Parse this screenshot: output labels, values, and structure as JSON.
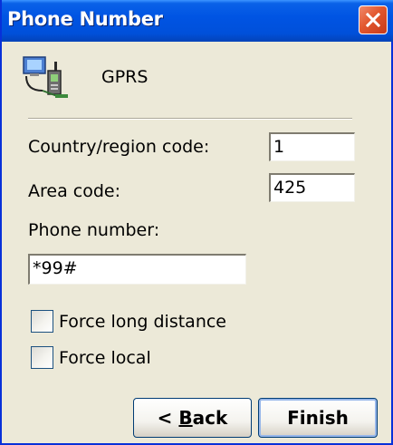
{
  "window": {
    "title": "Phone Number"
  },
  "connection": {
    "icon": "network-computers-icon",
    "name": "GPRS"
  },
  "fields": {
    "country_label": "Country/region code:",
    "country_value": "1",
    "area_label": "Area code:",
    "area_value": "425",
    "phone_label": "Phone number:",
    "phone_value": "*99#"
  },
  "options": {
    "force_long_distance": {
      "label": "Force long distance",
      "checked": false
    },
    "force_local": {
      "label": "Force local",
      "checked": false
    }
  },
  "buttons": {
    "back_prefix": "< ",
    "back_mnemonic": "B",
    "back_suffix": "ack",
    "finish": "Finish"
  },
  "colors": {
    "titlebar": "#0054E3",
    "window_bg": "#ECE9D8",
    "close_button": "#E2572E"
  }
}
